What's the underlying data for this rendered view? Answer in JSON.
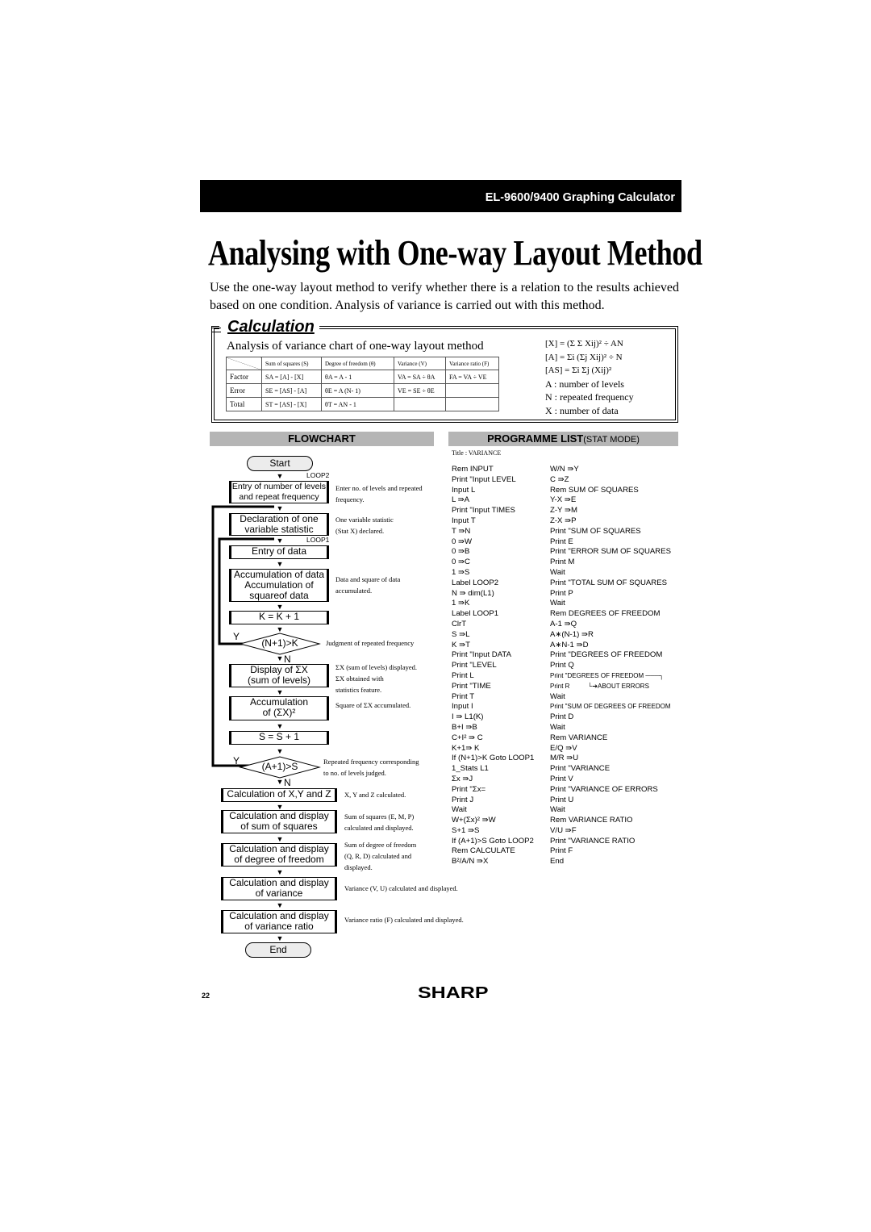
{
  "header": {
    "product": "EL-9600/9400 Graphing Calculator"
  },
  "page_title": "Analysing with One-way Layout Method",
  "intro": "Use the one-way layout method to verify whether there is a relation to the results achieved based on one condition. Analysis of variance is carried out with this method.",
  "calculation": {
    "title": "Calculation",
    "table_caption": "Analysis of variance chart of one-way layout method",
    "table": {
      "headers": [
        "",
        "Sum of squares (S)",
        "Degree of freedom (θ)",
        "Variance (V)",
        "Variance ratio (F)"
      ],
      "rows": [
        [
          "Factor",
          "SA = [A] - [X]",
          "θA = A - 1",
          "VA = SA ÷ θA",
          "FA = VA ÷ VE"
        ],
        [
          "Error",
          "SE = [AS] - [A]",
          "θE = A (N- 1)",
          "VE = SE ÷ θE",
          ""
        ],
        [
          "Total",
          "ST = [AS] - [X]",
          "θT = AN - 1",
          "",
          ""
        ]
      ]
    },
    "formulas": [
      "[X] = (Σ Σ Xij)² ÷ AN",
      "[A] = Σi (Σj Xij)² ÷ N",
      "[AS] = Σi Σj (Xij)²"
    ],
    "definitions": [
      "A : number of levels",
      "N : repeated frequency",
      "X : number of data"
    ]
  },
  "flowchart": {
    "heading": "FLOWCHART",
    "start": "Start",
    "end": "End",
    "loop2": "LOOP2",
    "loop1": "LOOP1",
    "yes": "Y",
    "no": "N",
    "steps": {
      "entry_levels": [
        "Entry of number of levels",
        "and repeat frequency"
      ],
      "declaration": [
        "Declaration of one",
        "variable statistic"
      ],
      "entry_data": [
        "Entry of data"
      ],
      "accumulation": [
        "Accumulation of data",
        "Accumulation of",
        "squareof data"
      ],
      "k_increment": [
        "K = K + 1"
      ],
      "decision_k": "(N+1)>K",
      "display_sum": [
        "Display of ΣX",
        "(sum of levels)"
      ],
      "accum_square": [
        "Accumulation",
        "of (ΣX)²"
      ],
      "s_increment": [
        "S = S + 1"
      ],
      "decision_s": "(A+1)>S",
      "calc_xyz": [
        "Calculation of X,Y and Z"
      ],
      "calc_sum_squares": [
        "Calculation and display",
        "of sum of squares"
      ],
      "calc_dof": [
        "Calculation and display",
        "of degree of freedom"
      ],
      "calc_variance": [
        "Calculation and display",
        "of variance"
      ],
      "calc_ratio": [
        "Calculation and display",
        "of variance ratio"
      ]
    },
    "notes": {
      "entry_levels": [
        "Enter no. of levels and repeated",
        "frequency."
      ],
      "declaration": [
        "One variable statistic",
        "(Stat X) declared."
      ],
      "accumulation": [
        "Data and square of data",
        "accumulated."
      ],
      "decision_k": [
        "Judgment of repeated frequency"
      ],
      "display_sum": [
        "ΣX (sum of levels) displayed.",
        "ΣX obtained with",
        "statistics feature."
      ],
      "accum_square": [
        "Square of ΣX accumulated."
      ],
      "decision_s": [
        "Repeated frequency corresponding",
        "to no. of levels judged."
      ],
      "calc_xyz": [
        "X, Y and Z calculated."
      ],
      "calc_sum_squares": [
        "Sum of squares (E, M, P)",
        "calculated and displayed."
      ],
      "calc_dof": [
        "Sum of degree of freedom",
        "(Q, R, D) calculated and",
        "displayed."
      ],
      "calc_variance": [
        "Variance (V, U) calculated and displayed."
      ],
      "calc_ratio": [
        "Variance ratio (F) calculated and displayed."
      ]
    }
  },
  "programme_list": {
    "heading": "PROGRAMME LIST",
    "heading_sub": "(STAT MODE)",
    "title": "Title : VARIANCE",
    "column1": [
      "Rem INPUT",
      "Print \"Input LEVEL",
      "Input L",
      "L ⇛A",
      "Print \"Input TIMES",
      "Input T",
      "T ⇛N",
      "0 ⇛W",
      "0 ⇛B",
      "0 ⇛C",
      "1 ⇛S",
      "Label LOOP2",
      "N ⇛ dim(L1)",
      "1 ⇛K",
      "Label LOOP1",
      "ClrT",
      "S ⇛L",
      "K ⇛T",
      "Print \"Input DATA",
      "Print \"LEVEL",
      "Print L",
      "Print \"TIME",
      "Print T",
      "Input I",
      "I ⇛ L1(K)",
      "B+I ⇛B",
      "C+I² ⇛ C",
      "K+1⇛ K",
      "If (N+1)>K Goto LOOP1",
      "1_Stats L1",
      "Σx ⇛J",
      "Print \"Σx=",
      "Print J",
      "Wait",
      "W+(Σx)² ⇛W",
      "S+1 ⇛S",
      "If (A+1)>S Goto LOOP2",
      "Rem CALCULATE",
      "B²/A/N ⇛X"
    ],
    "column2": [
      "W/N ⇛Y",
      "C ⇛Z",
      "Rem SUM OF SQUARES",
      "Y-X ⇛E",
      "Z-Y ⇛M",
      "Z-X ⇛P",
      "Print \"SUM OF SQUARES",
      "Print E",
      "Print \"ERROR SUM OF SQUARES",
      "Print M",
      "Wait",
      "Print \"TOTAL SUM OF SQUARES",
      "Print P",
      "Wait",
      "Rem DEGREES OF FREEDOM",
      "A-1 ⇛Q",
      "A∗(N-1) ⇛R",
      "A∗N-1 ⇛D",
      "Print \"DEGREES OF FREEDOM",
      "Print Q",
      "Print \"DEGREES OF FREEDOM ───┐",
      "Print R          └➔ABOUT ERRORS",
      "Wait",
      "Print \"SUM OF DEGREES OF FREEDOM",
      "Print D",
      "Wait",
      "Rem VARIANCE",
      "E/Q ⇛V",
      "M/R ⇛U",
      "Print \"VARIANCE",
      "Print V",
      "Print \"VARIANCE OF ERRORS",
      "Print U",
      "Wait",
      "Rem VARIANCE RATIO",
      "V/U ⇛F",
      "Print \"VARIANCE RATIO",
      "Print F",
      "End"
    ]
  },
  "footer": {
    "page_number": "22",
    "brand": "SHARP"
  }
}
